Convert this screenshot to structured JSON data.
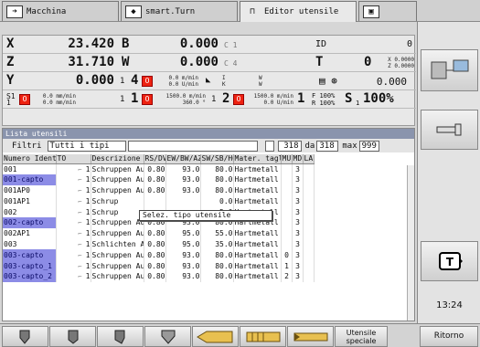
{
  "tabs": [
    {
      "label": "Macchina"
    },
    {
      "label": "smart.Turn"
    },
    {
      "label": "Editor utensile"
    },
    {
      "label": ""
    }
  ],
  "dro": {
    "x": {
      "axis": "X",
      "value": "23.420"
    },
    "z": {
      "axis": "Z",
      "value": "31.710"
    },
    "y": {
      "axis": "Y",
      "value": "0.000"
    },
    "b": {
      "axis": "B",
      "value": "0.000",
      "sub": "C 1"
    },
    "w": {
      "axis": "W",
      "value": "0.000",
      "sub": "C 4"
    },
    "id_label": "ID",
    "id_value": "0",
    "t_label": "T",
    "t_value": "0",
    "t_x": "X  0.0000",
    "t_z": "Z  0.0000",
    "feed1": "0.0 m/min",
    "feed1b": "0.0 U/min",
    "num1": "1",
    "num4": "4",
    "ik_i": "I",
    "ik_k": "K",
    "ik_iv": "W",
    "ik_kv": "W",
    "spindle_val": "0.000",
    "s1_top": "0.0 mm/min",
    "s1_bot": "0.0 mm/min",
    "s1": "S1",
    "s1_idx": "1",
    "m_num1": "1",
    "m_num1b": "1",
    "m_rate": "1500.0 m/min",
    "m_rate2": "360.0 °",
    "m_num2": "1",
    "m_num2b": "2",
    "m_rate3": "1500.0 m/min",
    "m_rate4": "0.0 U/min",
    "f_idx": "1",
    "f_label": "F",
    "f_pct": "100%",
    "r_label": "R",
    "r_pct": "100%",
    "s_label": "S",
    "s_idx": "1",
    "s_pct": "100%"
  },
  "list": {
    "title": "Lista utensili",
    "filter_label": "Filtri",
    "filter_value": "Tutti i tipi",
    "count": "318",
    "da_label": "da",
    "da_value": "318",
    "max_label": "max",
    "max_value": "999",
    "columns": [
      "Numero Ident",
      "TO",
      "Descrizione",
      "RS/DV",
      "EW/BW/AZ",
      "SW/SB/HG",
      "Mater. tagl.",
      "MU",
      "MD",
      "LA"
    ],
    "rows": [
      {
        "id": "001",
        "to": "1",
        "desc": "Schruppen Aussen",
        "rs": "0.80",
        "ew": "93.0",
        "sw": "80.0",
        "mat": "Hartmetall",
        "mu": "",
        "md": "3",
        "sel": false
      },
      {
        "id": "001-capto",
        "to": "1",
        "desc": "Schruppen Aussen",
        "rs": "0.80",
        "ew": "93.0",
        "sw": "80.0",
        "mat": "Hartmetall",
        "mu": "",
        "md": "3",
        "sel": true
      },
      {
        "id": "001AP0",
        "to": "1",
        "desc": "Schruppen Aussen",
        "rs": "0.80",
        "ew": "93.0",
        "sw": "80.0",
        "mat": "Hartmetall",
        "mu": "",
        "md": "3",
        "sel": false
      },
      {
        "id": "001AP1",
        "to": "1",
        "desc": "Schrup",
        "rs": "",
        "ew": "",
        "sw": "0.0",
        "mat": "Hartmetall",
        "mu": "",
        "md": "3",
        "sel": false
      },
      {
        "id": "002",
        "to": "1",
        "desc": "Schrup",
        "rs": "",
        "ew": "",
        "sw": "5.0",
        "mat": "Hartmetall",
        "mu": "",
        "md": "3",
        "sel": false
      },
      {
        "id": "002-capto",
        "to": "1",
        "desc": "Schruppen Aussen",
        "rs": "0.80",
        "ew": "93.0",
        "sw": "80.0",
        "mat": "Hartmetall",
        "mu": "",
        "md": "3",
        "sel": true
      },
      {
        "id": "002AP1",
        "to": "1",
        "desc": "Schruppen Aussen",
        "rs": "0.80",
        "ew": "95.0",
        "sw": "55.0",
        "mat": "Hartmetall",
        "mu": "",
        "md": "3",
        "sel": false
      },
      {
        "id": "003",
        "to": "1",
        "desc": "Schlichten Auss.",
        "rs": "0.80",
        "ew": "95.0",
        "sw": "35.0",
        "mat": "Hartmetall",
        "mu": "",
        "md": "3",
        "sel": false
      },
      {
        "id": "003-capto",
        "to": "1",
        "desc": "Schruppen Aussen",
        "rs": "0.80",
        "ew": "93.0",
        "sw": "80.0",
        "mat": "Hartmetall",
        "mu": "0",
        "md": "3",
        "sel": true
      },
      {
        "id": "003-capto_1",
        "to": "1",
        "desc": "Schruppen Aussen",
        "rs": "0.80",
        "ew": "93.0",
        "sw": "80.0",
        "mat": "Hartmetall",
        "mu": "1",
        "md": "3",
        "sel": true
      },
      {
        "id": "003-capto_2",
        "to": "1",
        "desc": "Schruppen Aussen",
        "rs": "0.80",
        "ew": "93.0",
        "sw": "80.0",
        "mat": "Hartmetall",
        "mu": "2",
        "md": "3",
        "sel": true
      }
    ]
  },
  "popup": "Selez. tipo utensile",
  "clock": "13:24",
  "softkeys": {
    "special": "Utensile speciale",
    "back": "Ritorno"
  }
}
